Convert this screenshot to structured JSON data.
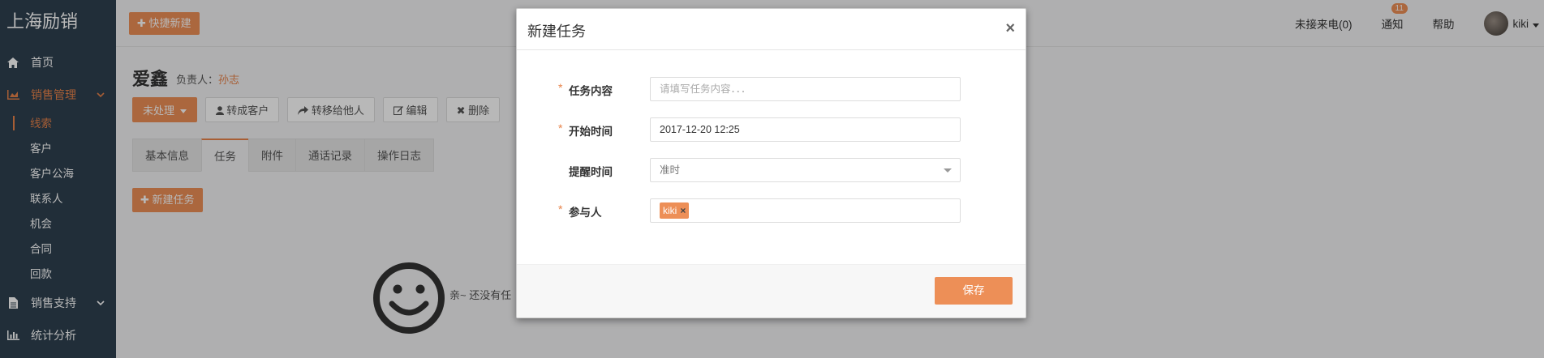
{
  "app": {
    "brand": "上海励销"
  },
  "sidebar": {
    "items": [
      {
        "label": "首页",
        "icon": "home-icon"
      },
      {
        "label": "销售管理",
        "icon": "chart-area-icon",
        "expanded": true
      },
      {
        "label": "销售支持",
        "icon": "file-icon"
      },
      {
        "label": "统计分析",
        "icon": "bar-chart-icon"
      }
    ],
    "sub_items": [
      "线索",
      "客户",
      "客户公海",
      "联系人",
      "机会",
      "合同",
      "回款"
    ],
    "active_sub": "线索"
  },
  "topbar": {
    "quick_new": "✚ 快捷新建",
    "missed_calls": "未接来电(0)",
    "notice": "通知",
    "notice_count": "11",
    "help": "帮助",
    "username": "kiki"
  },
  "lead": {
    "name": "爱鑫",
    "owner_label": "负责人：",
    "owner_name": "孙志"
  },
  "actions": {
    "status": "未处理",
    "convert": "转成客户",
    "transfer": "转移给他人",
    "edit": "编辑",
    "delete": "删除"
  },
  "tabs": [
    "基本信息",
    "任务",
    "附件",
    "通话记录",
    "操作日志"
  ],
  "active_tab": "任务",
  "task_panel": {
    "new_task": "✚ 新建任务",
    "empty_text": "亲~ 还没有任"
  },
  "modal": {
    "title": "新建任务",
    "close": "×",
    "fields": {
      "content_label": "任务内容",
      "content_placeholder": "请填写任务内容．．．",
      "start_label": "开始时间",
      "start_value": "2017-12-20 12:25",
      "remind_label": "提醒时间",
      "remind_value": "准时",
      "participants_label": "参与人",
      "participant_tag": "kiki",
      "required_mark": "*"
    },
    "save": "保存"
  },
  "colors": {
    "accent": "#ed8f57",
    "sidebar_bg": "#2f4050"
  }
}
